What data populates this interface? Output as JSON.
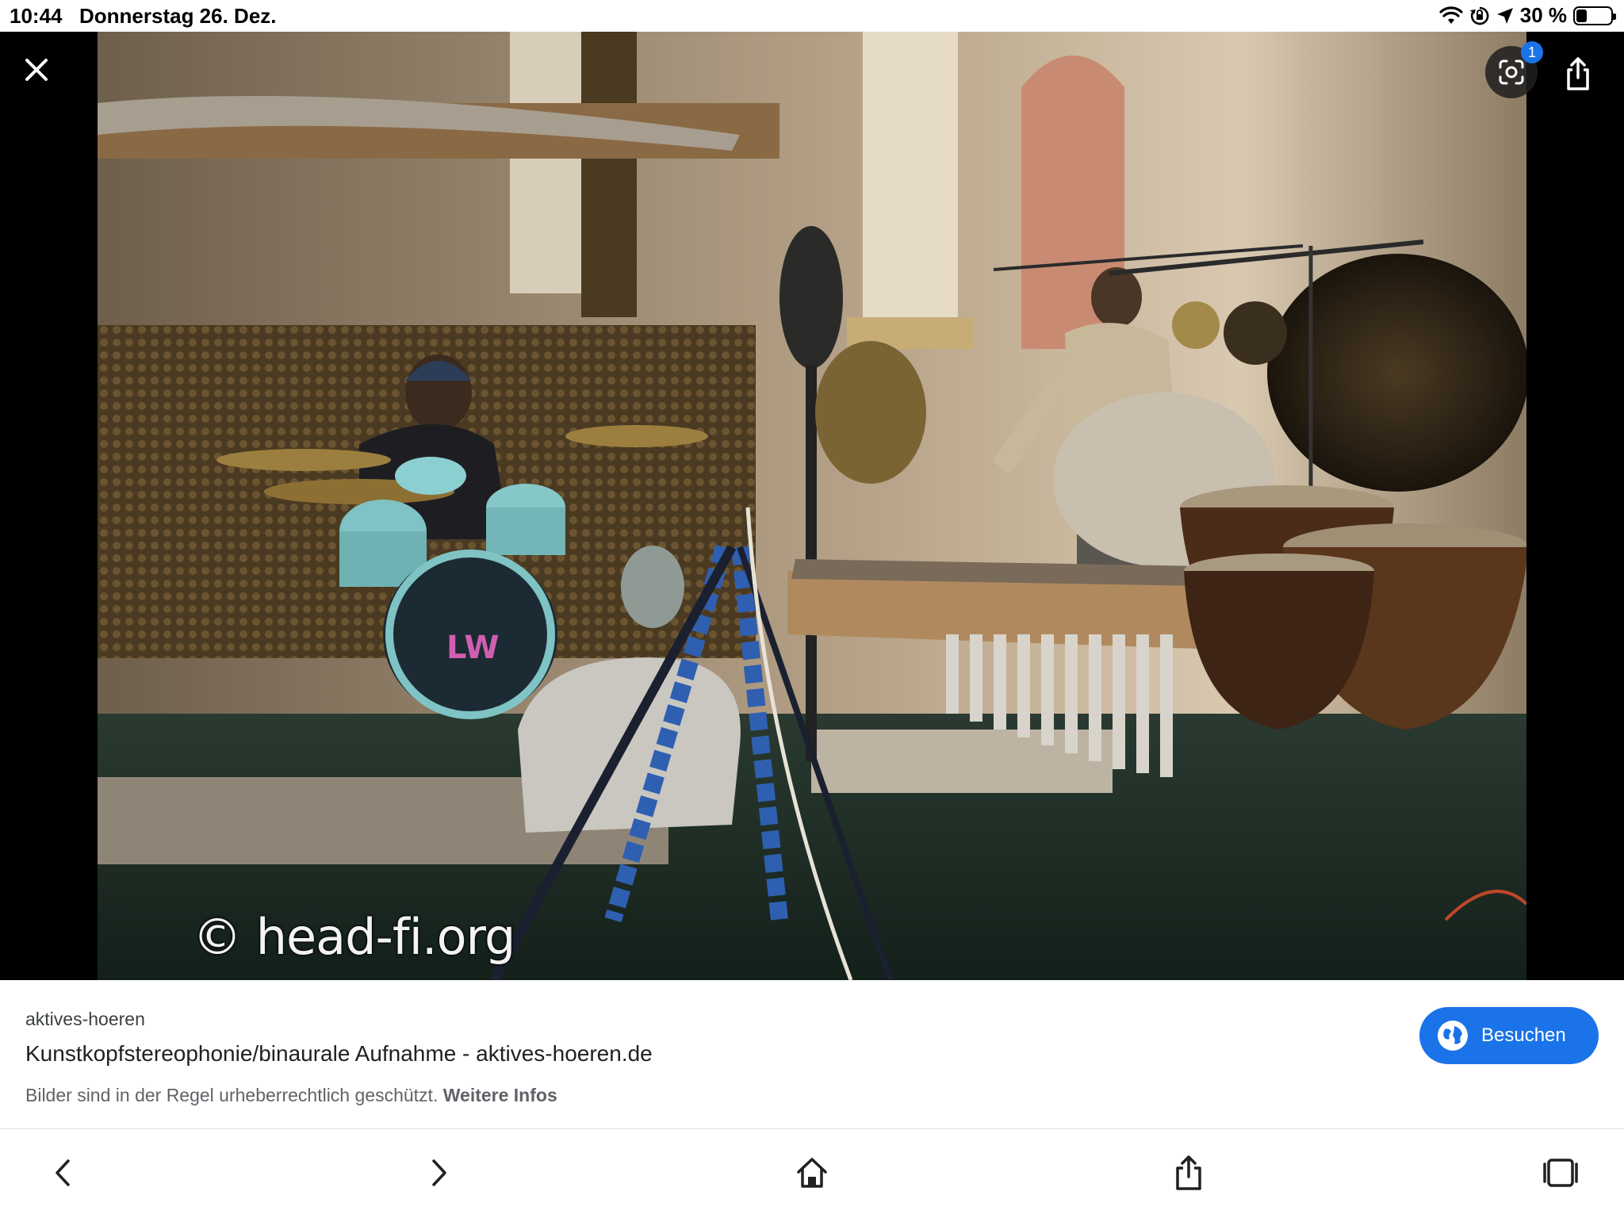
{
  "status_bar": {
    "time": "10:44",
    "date": "Donnerstag 26. Dez.",
    "battery_percent_label": "30 %",
    "battery_level": 0.3,
    "icons": [
      "wifi-icon",
      "orientation-lock-icon",
      "location-arrow-icon",
      "battery-icon"
    ]
  },
  "viewer": {
    "watermark": "© head-fi.org",
    "lens_badge_count": "1",
    "icons": [
      "close-icon",
      "google-lens-icon",
      "share-icon"
    ]
  },
  "info": {
    "source": "aktives-hoeren",
    "title": "Kunstkopfstereophonie/binaurale Aufnahme - aktives-hoeren.de",
    "notice": "Bilder sind in der Regel urheberrechtlich geschützt.",
    "more_info": "Weitere Infos",
    "visit_label": "Besuchen"
  },
  "toolbar": {
    "icons": [
      "back-icon",
      "forward-icon",
      "home-icon",
      "share-icon",
      "tabs-icon"
    ]
  },
  "colors": {
    "accent": "#1a73e8",
    "viewer_bg": "#000000"
  }
}
